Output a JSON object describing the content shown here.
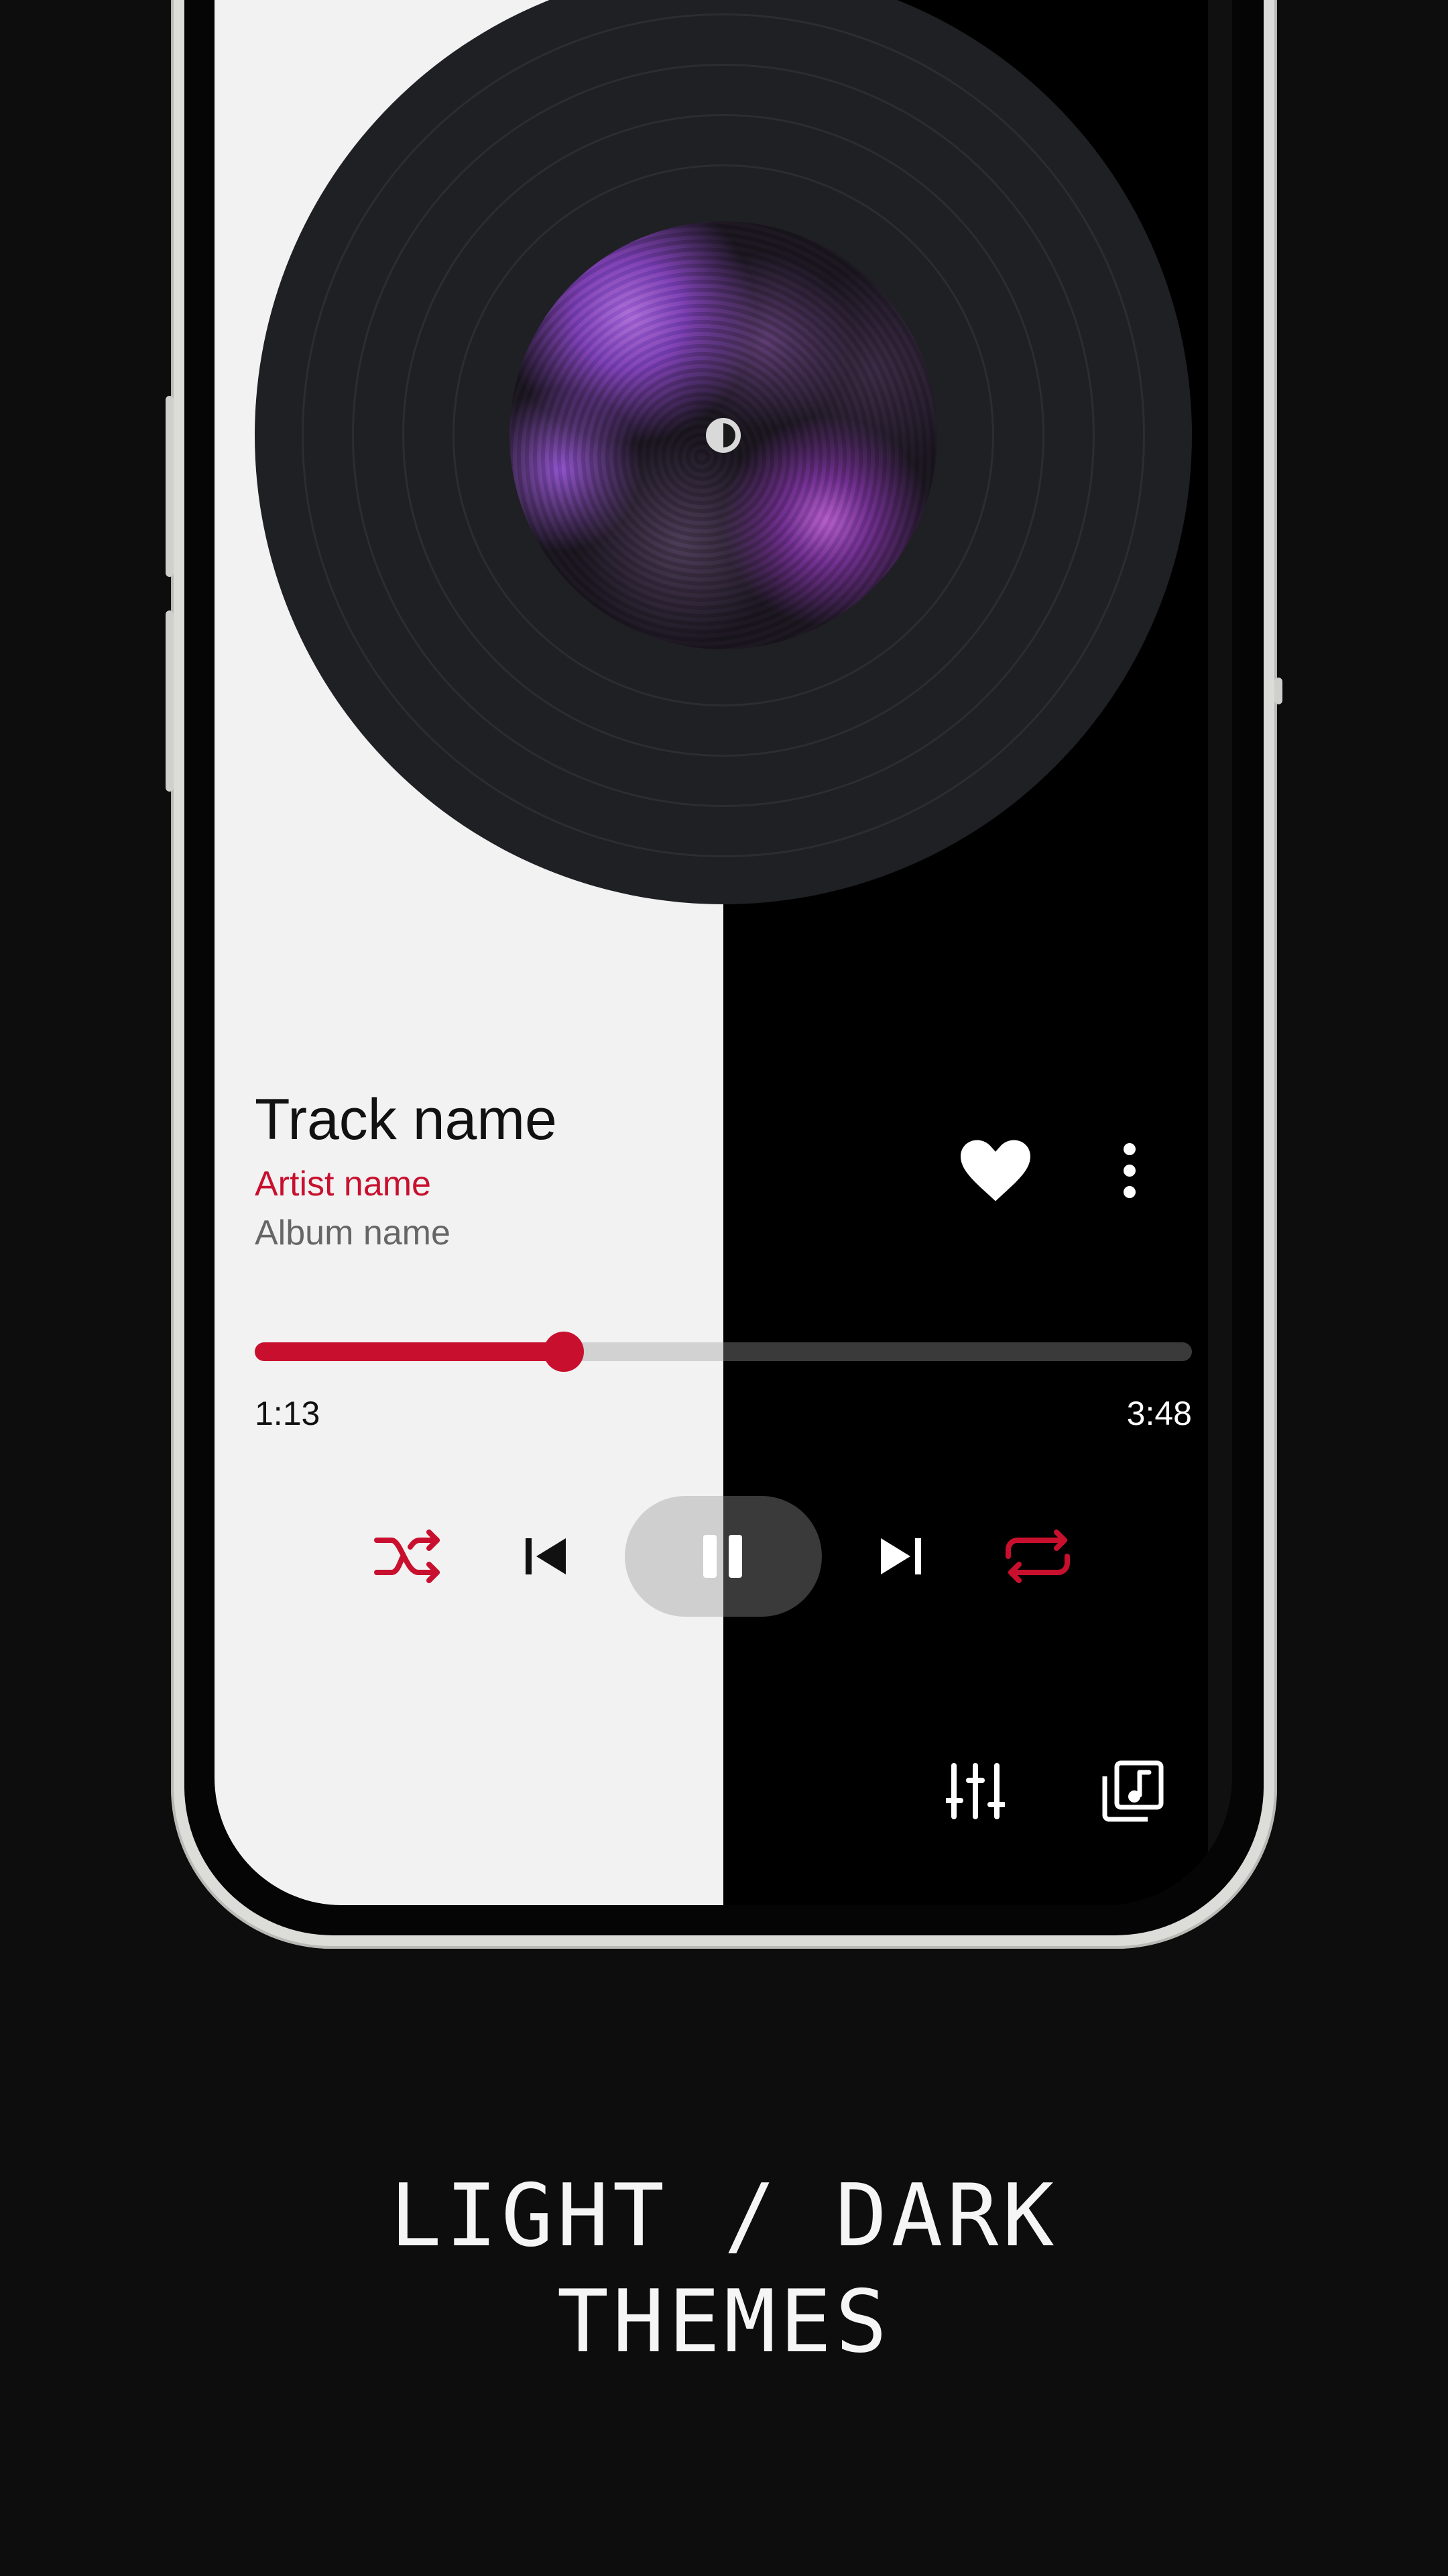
{
  "player": {
    "track_name": "Track name",
    "artist_name": "Artist name",
    "album_name": "Album name",
    "elapsed_time": "1:13",
    "total_time": "3:48",
    "progress": 0.33,
    "is_playing": true,
    "favorite": true
  },
  "controls": {
    "shuffle_icon": "shuffle-icon",
    "previous_icon": "skip-previous-icon",
    "play_pause_icon": "pause-icon",
    "next_icon": "skip-next-icon",
    "repeat_icon": "repeat-icon",
    "favorite_icon": "heart-icon",
    "more_icon": "more-vertical-icon",
    "equalizer_icon": "equalizer-icon",
    "queue_icon": "queue-music-icon"
  },
  "caption": {
    "line1": "LIGHT / DARK",
    "line2": "THEMES"
  },
  "colors": {
    "accent": "#c8102e",
    "light_background": "#f2f2f2",
    "dark_background": "#000000",
    "page_background": "#0d0d0d"
  }
}
